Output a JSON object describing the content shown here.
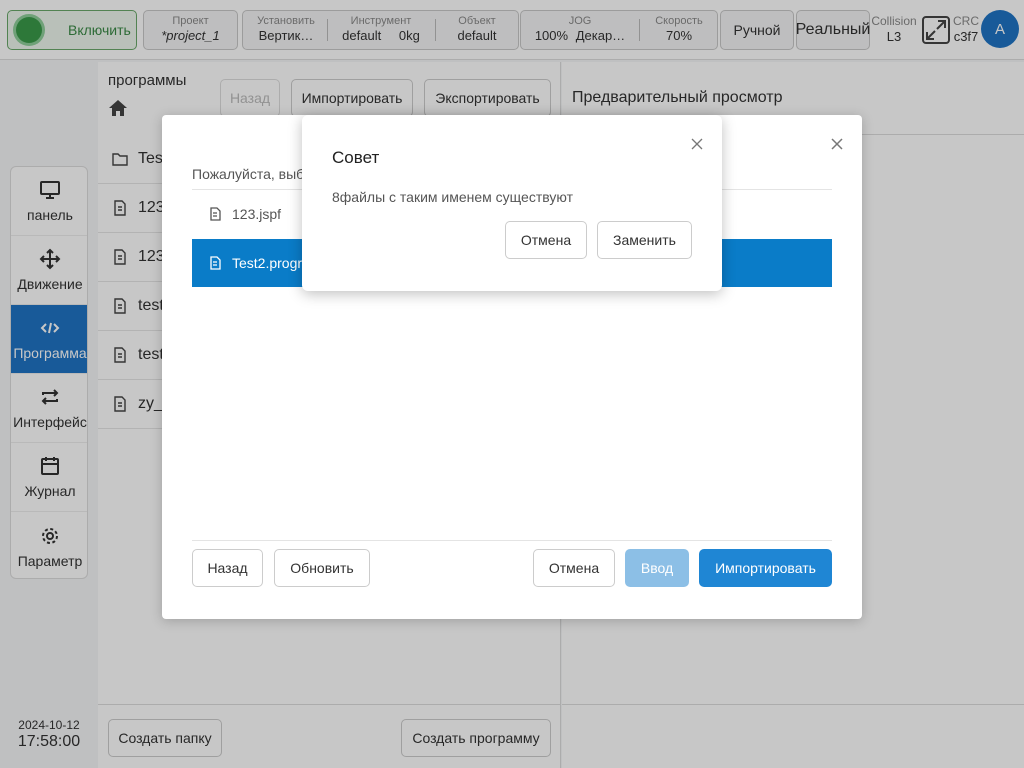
{
  "topbar": {
    "enable_label": "Включить",
    "project": {
      "caption": "Проект",
      "value": "*project_1"
    },
    "install": {
      "caption": "Установить",
      "value": "Вертик…"
    },
    "tool": {
      "caption": "Инструмент",
      "value": "default",
      "value2": "0kg"
    },
    "object": {
      "caption": "Объект",
      "value": "default"
    },
    "jog": {
      "caption": "JOG",
      "value": "100%",
      "value2": "Декар…"
    },
    "speed": {
      "caption": "Скорость",
      "value": "70%"
    },
    "mode_label": "Ручной",
    "real_label": "Реальный",
    "collision": {
      "caption": "Collision",
      "value": "L3"
    },
    "crc": {
      "caption": "CRC",
      "value": "c3f7"
    },
    "avatar": "A"
  },
  "nav": {
    "items": [
      {
        "label": "панель",
        "icon": "monitor-icon"
      },
      {
        "label": "Движение",
        "icon": "move-icon"
      },
      {
        "label": "Программа",
        "icon": "code-icon"
      },
      {
        "label": "Интерфейс",
        "icon": "swap-icon"
      },
      {
        "label": "Журнал",
        "icon": "calendar-icon"
      },
      {
        "label": "Параметр",
        "icon": "gear-icon"
      }
    ]
  },
  "datetime": {
    "date": "2024-10-12",
    "time": "17:58:00"
  },
  "files": {
    "title": "программы",
    "back_label": "Назад",
    "import_label": "Импортировать",
    "export_label": "Экспортировать",
    "rows": [
      {
        "name": "Tes",
        "type": "folder"
      },
      {
        "name": "123",
        "type": "file"
      },
      {
        "name": "123",
        "type": "file"
      },
      {
        "name": "test",
        "type": "file"
      },
      {
        "name": "test",
        "type": "file"
      },
      {
        "name": "zy_",
        "type": "file"
      }
    ],
    "create_folder_label": "Создать папку",
    "create_program_label": "Создать программу"
  },
  "preview": {
    "title": "Предварительный просмотр"
  },
  "import_dialog": {
    "prompt": "Пожалуйста, выб",
    "rows": [
      {
        "name": "123.jspf"
      },
      {
        "name": "Test2.progr"
      }
    ],
    "back_label": "Назад",
    "refresh_label": "Обновить",
    "cancel_label": "Отмена",
    "enter_label": "Ввод",
    "import_label": "Импортировать"
  },
  "message_dialog": {
    "title": "Совет",
    "message": "8файлы с таким именем существуют",
    "cancel_label": "Отмена",
    "replace_label": "Заменить"
  },
  "colors": {
    "accent": "#1f74c5",
    "selected_row": "#0a7cc8",
    "enable_green": "#3a9a4a"
  }
}
